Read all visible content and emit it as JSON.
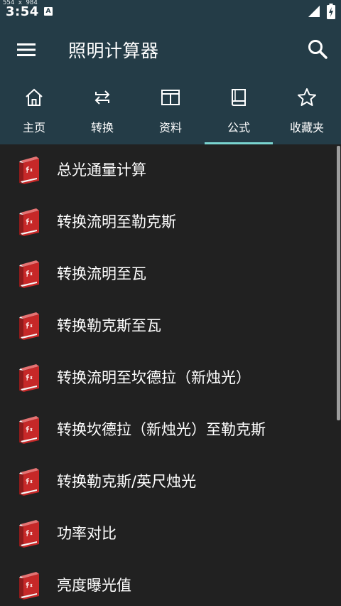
{
  "statusbar": {
    "dims": "554 x 984",
    "time": "3:54",
    "badge": "A"
  },
  "appbar": {
    "title": "照明计算器"
  },
  "tabs": [
    {
      "label": "主页",
      "icon": "home-icon"
    },
    {
      "label": "转换",
      "icon": "swap-icon"
    },
    {
      "label": "资料",
      "icon": "panel-icon"
    },
    {
      "label": "公式",
      "icon": "book-icon"
    },
    {
      "label": "收藏夹",
      "icon": "star-icon"
    }
  ],
  "active_tab": "公式",
  "items": [
    {
      "label": "总光通量计算"
    },
    {
      "label": "转换流明至勒克斯"
    },
    {
      "label": "转换流明至瓦"
    },
    {
      "label": "转换勒克斯至瓦"
    },
    {
      "label": "转换流明至坎德拉（新烛光）"
    },
    {
      "label": "转换坎德拉（新烛光）至勒克斯"
    },
    {
      "label": "转换勒克斯/英尺烛光"
    },
    {
      "label": "功率对比"
    },
    {
      "label": "亮度曝光值"
    }
  ],
  "colors": {
    "header": "#243c47",
    "background": "#212121",
    "accent": "#7ad4d0",
    "book_red": "#c62828"
  }
}
